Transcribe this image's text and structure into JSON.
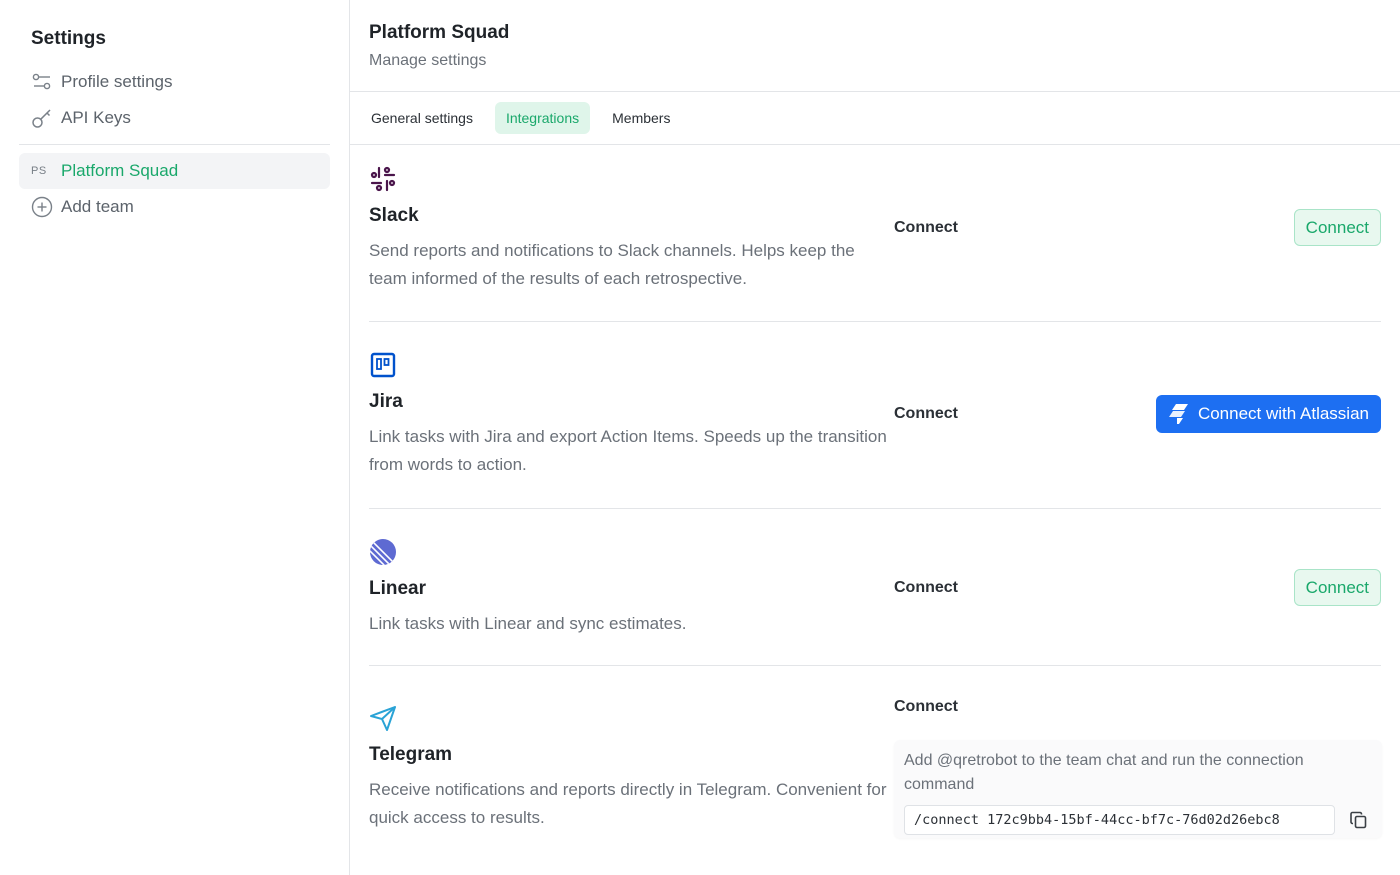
{
  "sidebar": {
    "title": "Settings",
    "items": [
      {
        "label": "Profile settings",
        "icon": "sliders-icon"
      },
      {
        "label": "API Keys",
        "icon": "key-icon"
      }
    ],
    "team": {
      "abbr": "PS",
      "label": "Platform Squad"
    },
    "add_team": {
      "label": "Add team",
      "icon": "plus-circle-icon"
    }
  },
  "header": {
    "title": "Platform Squad",
    "subtitle": "Manage settings"
  },
  "tabs": [
    {
      "label": "General settings",
      "active": false
    },
    {
      "label": "Integrations",
      "active": true
    },
    {
      "label": "Members",
      "active": false
    }
  ],
  "integrations": {
    "slack": {
      "name": "Slack",
      "description": "Send reports and notifications to Slack channels. Helps keep the team informed of the results of each retrospective.",
      "connect_label": "Connect",
      "button_label": "Connect"
    },
    "jira": {
      "name": "Jira",
      "description": "Link tasks with Jira and export Action Items. Speeds up the transition from words to action.",
      "connect_label": "Connect",
      "button_label": "Connect with Atlassian"
    },
    "linear": {
      "name": "Linear",
      "description": "Link tasks with Linear and sync estimates.",
      "connect_label": "Connect",
      "button_label": "Connect"
    },
    "telegram": {
      "name": "Telegram",
      "description": "Receive notifications and reports directly in Telegram. Convenient for quick access to results.",
      "connect_label": "Connect",
      "instruction": "Add @qretrobot to the team chat and run the connection command",
      "command": "/connect 172c9bb4-15bf-44cc-bf7c-76d02d26ebc8"
    }
  },
  "colors": {
    "accent_green": "#1aa86b",
    "atlassian_blue": "#1d6ff2",
    "slack_purple": "#4a154b",
    "jira_blue": "#0052cc",
    "linear_indigo": "#5e6ad2",
    "telegram_blue": "#2aa3d6"
  }
}
